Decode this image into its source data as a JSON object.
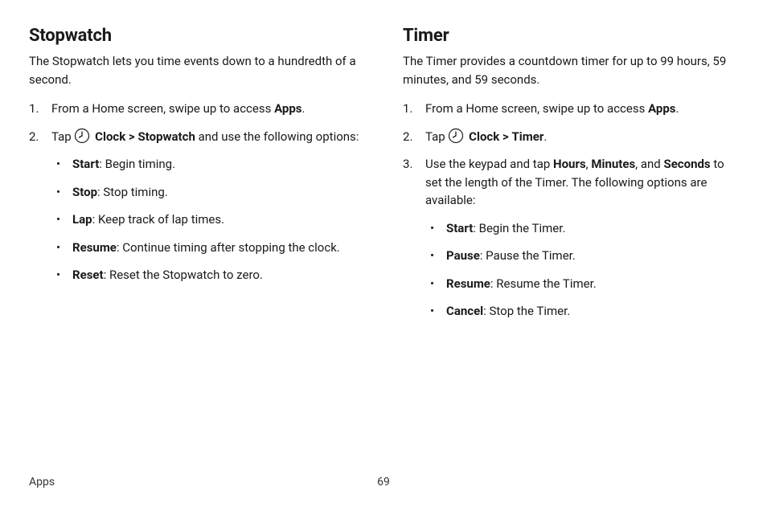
{
  "left": {
    "heading": "Stopwatch",
    "intro": "The Stopwatch lets you time events down to a hundredth of a second.",
    "step1_pre": "From a Home screen, swipe up to access ",
    "step1_bold": "Apps",
    "step1_post": ".",
    "step2_pre": "Tap ",
    "step2_clock": "Clock",
    "step2_arrow": ">",
    "step2_target": "Stopwatch",
    "step2_post": " and use the following options:",
    "bullets": [
      {
        "term": "Start",
        "desc": ": Begin timing."
      },
      {
        "term": "Stop",
        "desc": ": Stop timing."
      },
      {
        "term": "Lap",
        "desc": ": Keep track of lap times."
      },
      {
        "term": "Resume",
        "desc": ": Continue timing after stopping the clock."
      },
      {
        "term": "Reset",
        "desc": ": Reset the Stopwatch to zero."
      }
    ]
  },
  "right": {
    "heading": "Timer",
    "intro": "The Timer provides a countdown timer for up to 99 hours, 59 minutes, and 59 seconds.",
    "step1_pre": "From a Home screen, swipe up to access ",
    "step1_bold": "Apps",
    "step1_post": ".",
    "step2_pre": "Tap ",
    "step2_clock": "Clock",
    "step2_arrow": ">",
    "step2_target": "Timer",
    "step2_post": ".",
    "step3_pre": "Use the keypad and tap ",
    "step3_b1": "Hours",
    "step3_c1": ", ",
    "step3_b2": "Minutes",
    "step3_c2": ", and ",
    "step3_b3": "Seconds",
    "step3_post": " to set the length of the Timer. The following options are available:",
    "bullets": [
      {
        "term": "Start",
        "desc": ": Begin the Timer."
      },
      {
        "term": "Pause",
        "desc": ": Pause the Timer."
      },
      {
        "term": "Resume",
        "desc": ": Resume the Timer."
      },
      {
        "term": "Cancel",
        "desc": ": Stop the Timer."
      }
    ]
  },
  "footer": {
    "section": "Apps",
    "page": "69"
  }
}
